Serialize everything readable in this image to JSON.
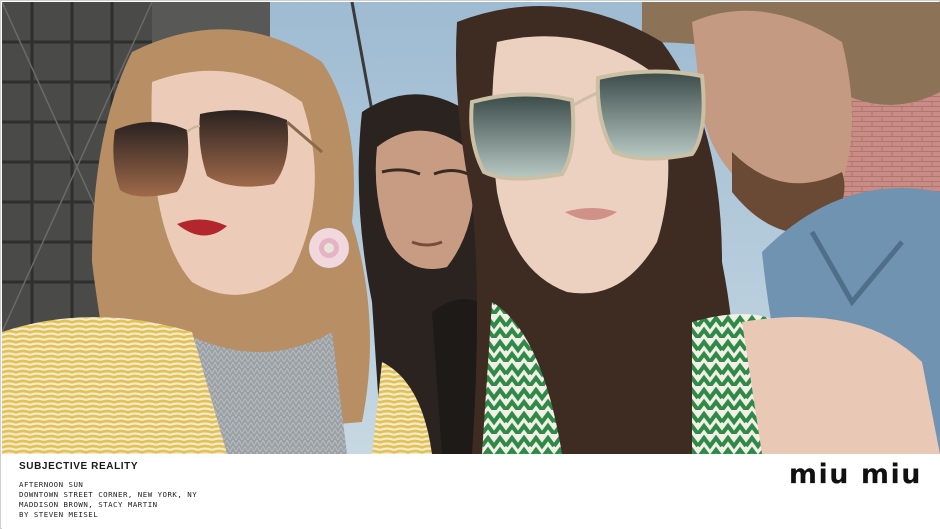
{
  "campaign": {
    "title": "SUBJECTIVE REALITY",
    "credits": [
      "AFTERNOON SUN",
      "DOWNTOWN STREET CORNER, NEW YORK, NY",
      "MADDISON BROWN, STACY MARTIN",
      "BY STEVEN MEISEL"
    ],
    "brand": "miu miu"
  },
  "photo": {
    "subjects": [
      "woman-left-sunglasses",
      "older-woman-center",
      "woman-right-sunglasses",
      "man-right-hat"
    ],
    "colors": {
      "sky": "#a9c4d8",
      "building_left": "#4a4a48",
      "brick_wall": "#c98d86",
      "coat_yellow": "#e2c253",
      "sweater": "#9aa0a4",
      "dress_green": "#2f8a47",
      "denim": "#6f93b0",
      "skin": "#e9c8b5",
      "hair_left": "#b88e64",
      "hair_right": "#3e2c22"
    }
  }
}
